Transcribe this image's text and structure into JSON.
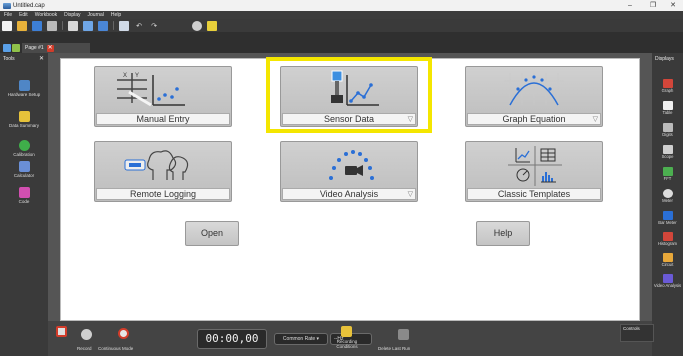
{
  "window": {
    "title": "Untitled.cap",
    "minimize": "–",
    "maximize": "❐",
    "close": "✕"
  },
  "menu": [
    "File",
    "Edit",
    "Workbook",
    "Display",
    "Journal",
    "Help"
  ],
  "tabs": {
    "page_label": "Page #1",
    "close": "✕"
  },
  "tools_panel": {
    "title": "Tools",
    "close": "✕",
    "items": [
      {
        "label": "Hardware Setup",
        "icon": "hardware-icon"
      },
      {
        "label": "Data Summary",
        "icon": "data-summary-icon"
      },
      {
        "label": "Calibration",
        "icon": "calibration-icon"
      },
      {
        "label": "Calculator",
        "icon": "calculator-icon"
      },
      {
        "label": "Code",
        "icon": "code-icon"
      }
    ]
  },
  "cards": [
    {
      "label": "Manual Entry",
      "has_dropdown": false
    },
    {
      "label": "Sensor Data",
      "has_dropdown": true,
      "highlighted": true
    },
    {
      "label": "Graph Equation",
      "has_dropdown": true
    },
    {
      "label": "Remote Logging",
      "has_dropdown": false
    },
    {
      "label": "Video Analysis",
      "has_dropdown": true
    },
    {
      "label": "Classic Templates",
      "has_dropdown": false
    }
  ],
  "buttons": {
    "open": "Open",
    "help": "Help"
  },
  "displays_panel": {
    "title": "Displays",
    "items": [
      {
        "label": "Graph",
        "icon": "graph-icon"
      },
      {
        "label": "Table",
        "icon": "table-icon"
      },
      {
        "label": "Digits",
        "icon": "digits-icon"
      },
      {
        "label": "Scope",
        "icon": "scope-icon"
      },
      {
        "label": "FFT",
        "icon": "fft-icon"
      },
      {
        "label": "Meter",
        "icon": "meter-icon"
      },
      {
        "label": "Bar Meter",
        "icon": "bar-meter-icon"
      },
      {
        "label": "Histogram",
        "icon": "histogram-icon"
      },
      {
        "label": "Circuit",
        "icon": "circuit-icon"
      },
      {
        "label": "Video Analysis",
        "icon": "video-analysis-icon"
      }
    ]
  },
  "controls": {
    "record_label": "Record",
    "mode_label": "Continuous Mode",
    "timer": "00:00,00",
    "rate_label": "Common Rate",
    "hz_value": "--Hz",
    "recording_conditions": "Recording Conditions",
    "delete_last_run": "Delete Last Run",
    "panel_title": "Controls"
  },
  "colors": {
    "highlight": "#f4e600",
    "accent_blue": "#2a6fd6",
    "close_red": "#d23c2a"
  }
}
